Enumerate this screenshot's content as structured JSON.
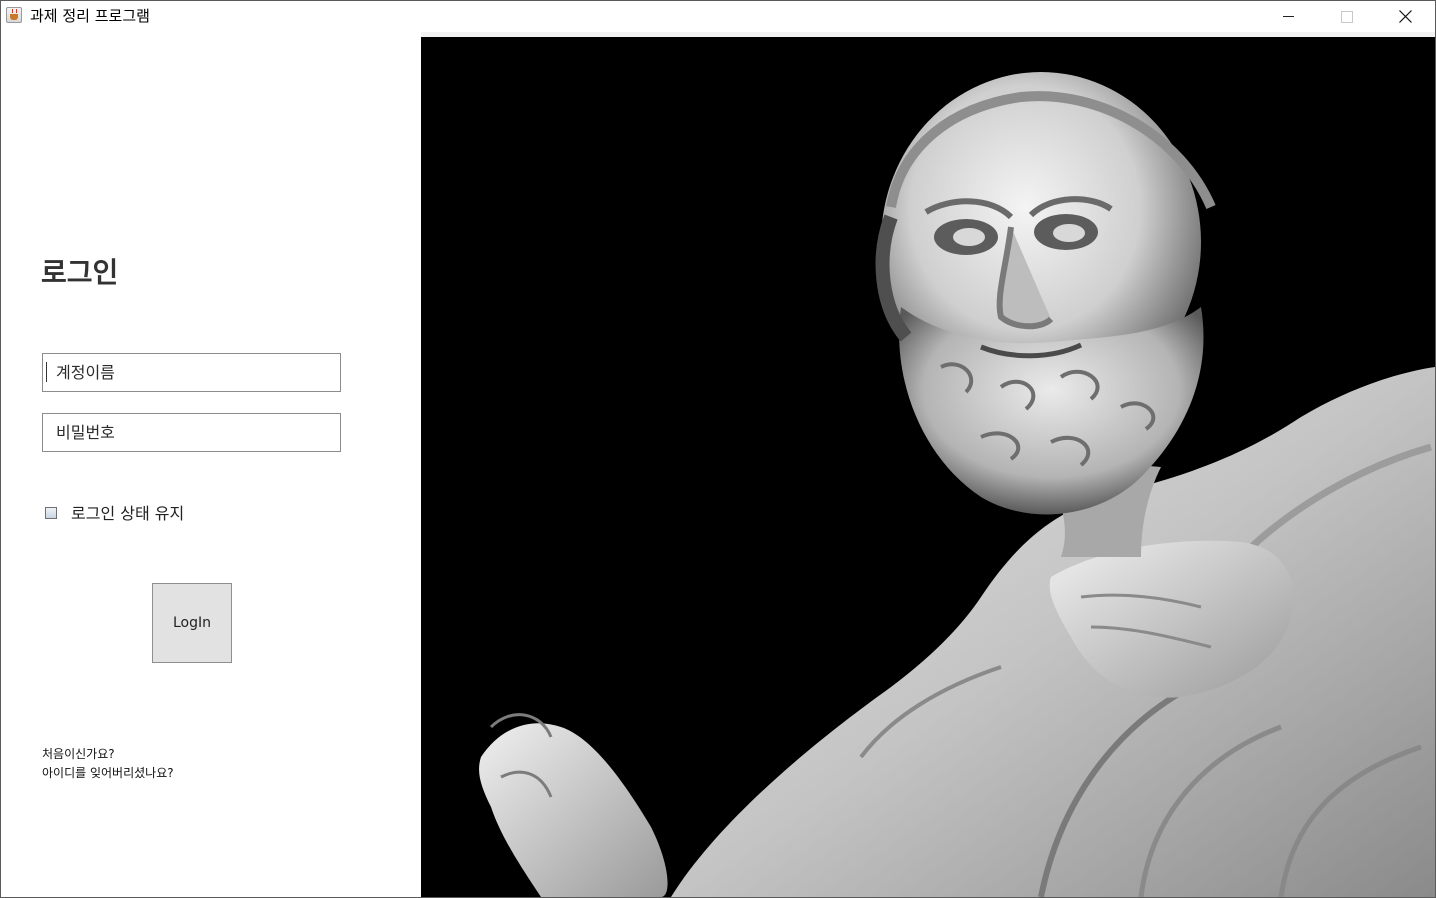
{
  "window": {
    "title": "과제 정리 프로그램",
    "app_icon": "java-cup-icon",
    "controls": [
      "minimize-icon",
      "maximize-icon",
      "close-icon"
    ]
  },
  "login": {
    "heading": "로그인",
    "username_field": {
      "value": "계정이름"
    },
    "password_field": {
      "value": "비밀번호"
    },
    "remember_label": "로그인 상태 유지",
    "remember_checked": false,
    "login_button_label": "LogIn",
    "help": {
      "first_time": "처음이신가요?",
      "forgot_id": "아이디를 잊어버리셨나요?"
    }
  },
  "hero_image": {
    "subject": "marble-statue-image",
    "background_color": "#000000"
  }
}
